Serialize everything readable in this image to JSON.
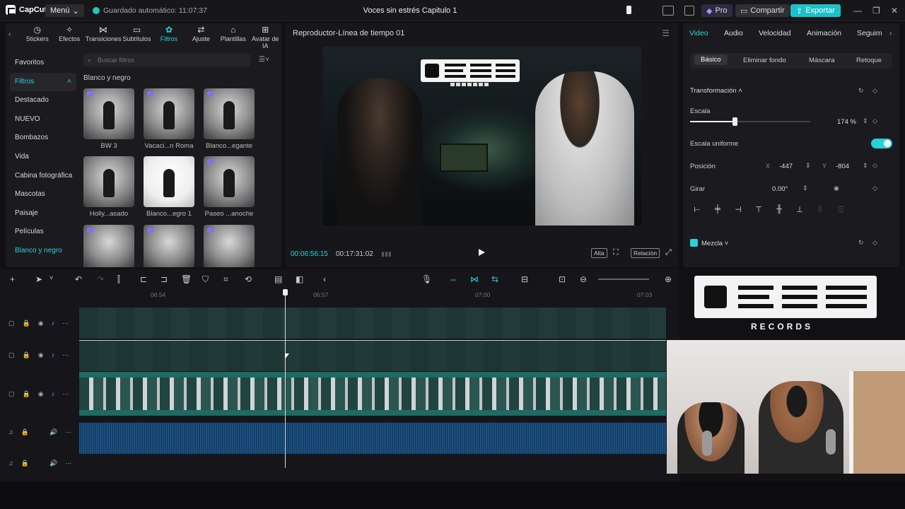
{
  "topbar": {
    "app_name": "CapCut",
    "menu_label": "Menú",
    "autosave": "Guardado automático: 11:07:37",
    "project_title": "Voces sin estrés Capitulo 1",
    "pro_label": "Pro",
    "share_label": "Compartir",
    "export_label": "Exportar"
  },
  "tools": {
    "tabs": [
      {
        "label": "Stickers",
        "icon": "sticker-icon"
      },
      {
        "label": "Efectos",
        "icon": "effects-icon"
      },
      {
        "label": "Transiciones",
        "icon": "transitions-icon"
      },
      {
        "label": "Subtítulos",
        "icon": "subtitles-icon"
      },
      {
        "label": "Filtros",
        "icon": "filters-icon"
      },
      {
        "label": "Ajuste",
        "icon": "adjust-icon"
      },
      {
        "label": "Plantillas",
        "icon": "templates-icon"
      },
      {
        "label": "Avatar de IA",
        "icon": "ai-avatar-icon"
      }
    ],
    "active_tab": "Filtros"
  },
  "filters_sidebar": {
    "items": [
      "Favoritos",
      "Filtros",
      "Destacado",
      "NUEVO",
      "Bombazos",
      "Vida",
      "Cabina fotográfica",
      "Mascotas",
      "Paisaje",
      "Películas",
      "Blanco y negro"
    ],
    "selected": "Filtros"
  },
  "filters_panel": {
    "search_placeholder": "Buscar filtros",
    "group_title": "Blanco y negro",
    "thumbs": [
      {
        "label": "BW 3"
      },
      {
        "label": "Vacaci...n Roma"
      },
      {
        "label": "Blanco...egante"
      },
      {
        "label": "Holly...asado"
      },
      {
        "label": "Blanco...egro 1"
      },
      {
        "label": "Paseo ...anoche"
      }
    ]
  },
  "player": {
    "title": "Reproductor-Línea de tiempo 01",
    "current_time": "00:06:56:15",
    "total_time": "00:17:31:02",
    "quality_label": "Alta",
    "ratio_label": "Relación"
  },
  "props": {
    "tabs": [
      "Video",
      "Audio",
      "Velocidad",
      "Animación",
      "Seguim"
    ],
    "active_tab": "Video",
    "subtabs": [
      "Básico",
      "Eliminar fondo",
      "Máscara",
      "Retoque"
    ],
    "active_subtab": "Básico",
    "transform_title": "Transformación",
    "scale_label": "Escala",
    "scale_value": "174 %",
    "scale_fraction": 0.37,
    "uniform_scale_label": "Escala uniforme",
    "position_label": "Posición",
    "pos_x_axis": "X",
    "pos_x": "-447",
    "pos_y_axis": "Y",
    "pos_y": "-804",
    "rotate_label": "Girar",
    "rotate_value": "0.00°",
    "blend_label": "Mezcla"
  },
  "overlay": {
    "brand_sub": "RECORDS"
  },
  "timeline": {
    "ruler_ticks": [
      "06:54",
      "06:57",
      "07:00",
      "07:03"
    ]
  },
  "colors": {
    "accent": "#2ad0d8",
    "export": "#1ec0c8",
    "audio_wave": "#1c5a93"
  }
}
